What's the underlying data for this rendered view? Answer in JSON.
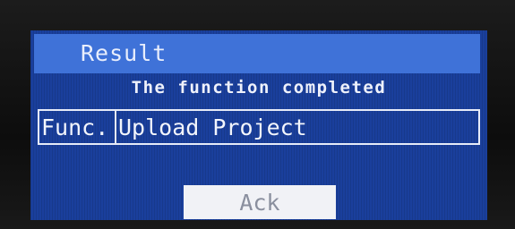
{
  "dialog": {
    "title": "Result",
    "message": "The function completed"
  },
  "function_row": {
    "label": "Func.",
    "value": "Upload Project"
  },
  "actions": {
    "ack_label": "Ack"
  },
  "colors": {
    "screen_background": "#1a3f9c",
    "title_bar": "#3f72d8",
    "text": "#eef1fb",
    "button_background": "#f1f2f6",
    "button_text": "#8a8f9e"
  }
}
